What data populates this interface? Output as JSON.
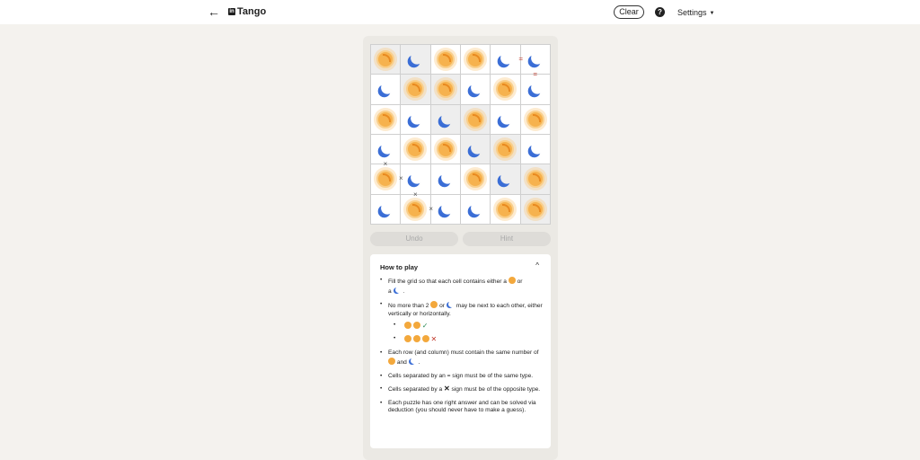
{
  "header": {
    "back_glyph": "←",
    "logo_text": "in",
    "title": "Tango",
    "clear_label": "Clear",
    "help_glyph": "?",
    "settings_label": "Settings"
  },
  "board": {
    "rows": [
      [
        "sun",
        "moon",
        "sun",
        "sun",
        "moon",
        "moon"
      ],
      [
        "moon",
        "sun",
        "sun",
        "moon",
        "sun",
        "moon"
      ],
      [
        "sun",
        "moon",
        "moon",
        "sun",
        "moon",
        "sun"
      ],
      [
        "moon",
        "sun",
        "sun",
        "moon",
        "sun",
        "moon"
      ],
      [
        "sun",
        "moon",
        "moon",
        "sun",
        "moon",
        "sun"
      ],
      [
        "moon",
        "sun",
        "moon",
        "moon",
        "sun",
        "sun"
      ]
    ],
    "locked": [
      [
        true,
        true,
        false,
        false,
        false,
        false
      ],
      [
        false,
        true,
        true,
        false,
        false,
        false
      ],
      [
        false,
        false,
        true,
        true,
        false,
        false
      ],
      [
        false,
        false,
        false,
        true,
        true,
        false
      ],
      [
        false,
        false,
        false,
        false,
        true,
        true
      ],
      [
        false,
        false,
        false,
        false,
        false,
        true
      ]
    ],
    "signs": [
      {
        "row": 0,
        "col": 4,
        "dir": "h",
        "sign": "="
      },
      {
        "row": 0,
        "col": 5,
        "dir": "v",
        "sign": "="
      },
      {
        "row": 3,
        "col": 0,
        "dir": "v",
        "sign": "×"
      },
      {
        "row": 4,
        "col": 0,
        "dir": "h",
        "sign": "×"
      },
      {
        "row": 4,
        "col": 1,
        "dir": "v",
        "sign": "×"
      },
      {
        "row": 5,
        "col": 1,
        "dir": "h",
        "sign": "×"
      }
    ],
    "colors": {
      "sun": "#f6b24e",
      "moon": "#3b6ed6",
      "locked_cell": "#eeeeee"
    }
  },
  "controls": {
    "undo_label": "Undo",
    "hint_label": "Hint"
  },
  "how_to_play": {
    "title": "How to play",
    "collapse_glyph": "^",
    "rule1_a": "Fill the grid so that each cell contains either a",
    "rule1_b": "or",
    "rule1_c": "a",
    "rule1_d": ".",
    "rule2_a": "No more than 2",
    "rule2_b": "or",
    "rule2_c": "may be next to each other, either vertically or horizontally.",
    "check": "✓",
    "cross": "✕",
    "rule3_a": "Each row (and column) must contain the same number of",
    "rule3_b": "and",
    "rule3_c": ".",
    "rule4": "Cells separated by an = sign must be of the same type.",
    "rule5_a": "Cells separated by a",
    "rule5_sign": "✕",
    "rule5_b": "sign must be of the opposite type.",
    "rule6": "Each puzzle has one right answer and can be solved via deduction (you should never have to make a guess)."
  }
}
